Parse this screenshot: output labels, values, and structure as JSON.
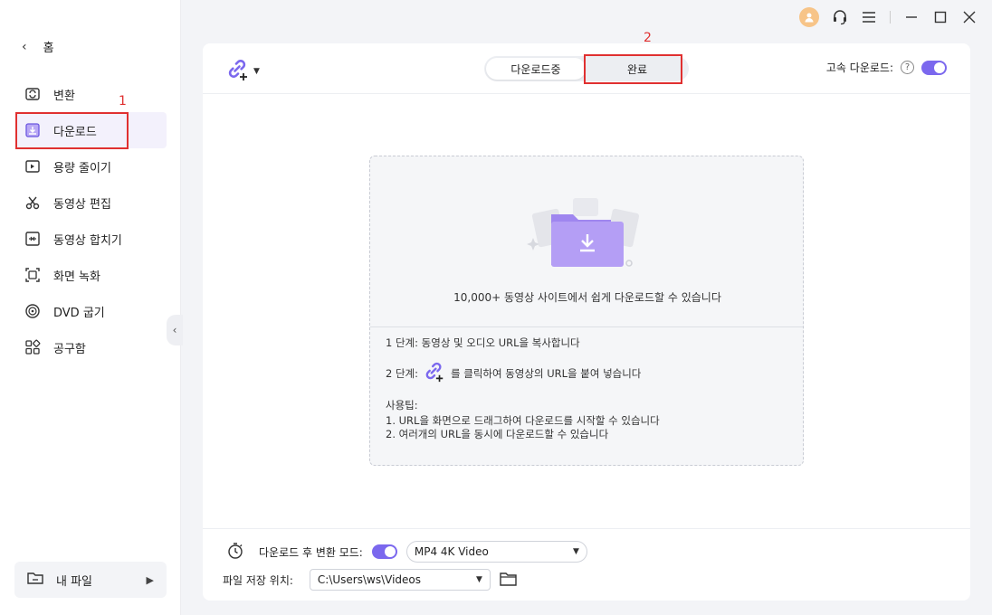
{
  "sidebar": {
    "home_label": "홈",
    "items": [
      {
        "label": "변환",
        "icon": "convert-icon"
      },
      {
        "label": "다운로드",
        "icon": "download-icon"
      },
      {
        "label": "용량 줄이기",
        "icon": "compress-icon"
      },
      {
        "label": "동영상 편집",
        "icon": "scissors-icon"
      },
      {
        "label": "동영상 합치기",
        "icon": "merge-icon"
      },
      {
        "label": "화면 녹화",
        "icon": "screen-record-icon"
      },
      {
        "label": "DVD 굽기",
        "icon": "dvd-icon"
      },
      {
        "label": "공구함",
        "icon": "toolbox-icon"
      }
    ],
    "active_item": "다운로드",
    "my_files_label": "내 파일"
  },
  "annotations": {
    "marker1": "1",
    "marker2": "2"
  },
  "toolbar": {
    "tabs": [
      "다운로드중",
      "완료"
    ],
    "selected_tab": "다운로드중",
    "high_speed_label": "고속 다운로드:",
    "high_speed_enabled": true
  },
  "dropzone": {
    "title": "10,000+ 동영상 사이트에서 쉽게 다운로드할 수 있습니다",
    "step1": "1 단계: 동영상 및 오디오 URL을 복사합니다",
    "step2_prefix": "2 단계:",
    "step2_suffix": "를 클릭하여 동영상의 URL을 붙여 넣습니다",
    "tips_heading": "사용팁:",
    "tip1": "1. URL을 화면으로 드래그하여 다운로드를 시작할 수 있습니다",
    "tip2": "2. 여러개의 URL을 동시에 다운로드할 수 있습니다"
  },
  "bottom": {
    "convert_mode_label": "다운로드 후 변환 모드:",
    "convert_mode_enabled": true,
    "format_value": "MP4 4K Video",
    "save_location_label": "파일 저장 위치:",
    "save_path": "C:\\Users\\ws\\Videos"
  },
  "colors": {
    "accent": "#7b68ee",
    "annotation_red": "#e03030"
  }
}
